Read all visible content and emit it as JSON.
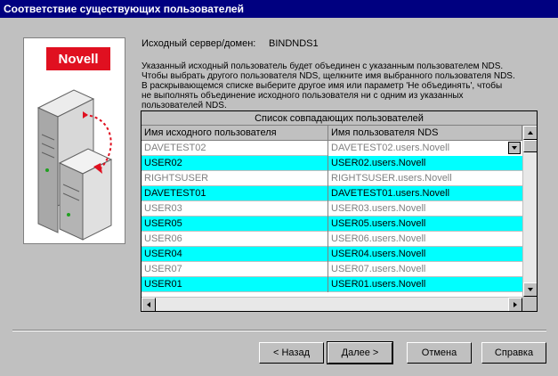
{
  "window": {
    "title": "Соответствие существующих пользователей"
  },
  "brand": {
    "logo_text": "Novell"
  },
  "info": {
    "source_label": "Исходный сервер/домен:",
    "source_value": "BINDNDS1"
  },
  "description": [
    "Указанный исходный пользователь будет объединен с указанным пользователем NDS.",
    "Чтобы выбрать другого пользователя NDS, щелкните имя выбранного пользователя NDS.",
    "В раскрывающемся списке выберите другое имя или параметр 'Не объединять', чтобы",
    "не выполнять объединение исходного пользователя ни с одним из указанных",
    "пользователей NDS."
  ],
  "grid": {
    "caption": "Список совпадающих пользователей",
    "columns": [
      "Имя исходного пользователя",
      "Имя пользователя NDS"
    ],
    "rows": [
      {
        "source": "DAVETEST02",
        "nds": "DAVETEST02.users.Novell",
        "highlight": false,
        "editing": true
      },
      {
        "source": "USER02",
        "nds": "USER02.users.Novell",
        "highlight": true,
        "editing": false
      },
      {
        "source": "RIGHTSUSER",
        "nds": "RIGHTSUSER.users.Novell",
        "highlight": false,
        "editing": false
      },
      {
        "source": "DAVETEST01",
        "nds": "DAVETEST01.users.Novell",
        "highlight": true,
        "editing": false
      },
      {
        "source": "USER03",
        "nds": "USER03.users.Novell",
        "highlight": false,
        "editing": false
      },
      {
        "source": "USER05",
        "nds": "USER05.users.Novell",
        "highlight": true,
        "editing": false
      },
      {
        "source": "USER06",
        "nds": "USER06.users.Novell",
        "highlight": false,
        "editing": false
      },
      {
        "source": "USER04",
        "nds": "USER04.users.Novell",
        "highlight": true,
        "editing": false
      },
      {
        "source": "USER07",
        "nds": "USER07.users.Novell",
        "highlight": false,
        "editing": false
      },
      {
        "source": "USER01",
        "nds": "USER01.users.Novell",
        "highlight": true,
        "editing": false
      }
    ]
  },
  "buttons": {
    "back": "< Назад",
    "next": "Далее >",
    "cancel": "Отмена",
    "help": "Справка"
  },
  "colors": {
    "title_bar": "#000080",
    "highlight_row": "#00ffff",
    "logo_red": "#e01020"
  }
}
